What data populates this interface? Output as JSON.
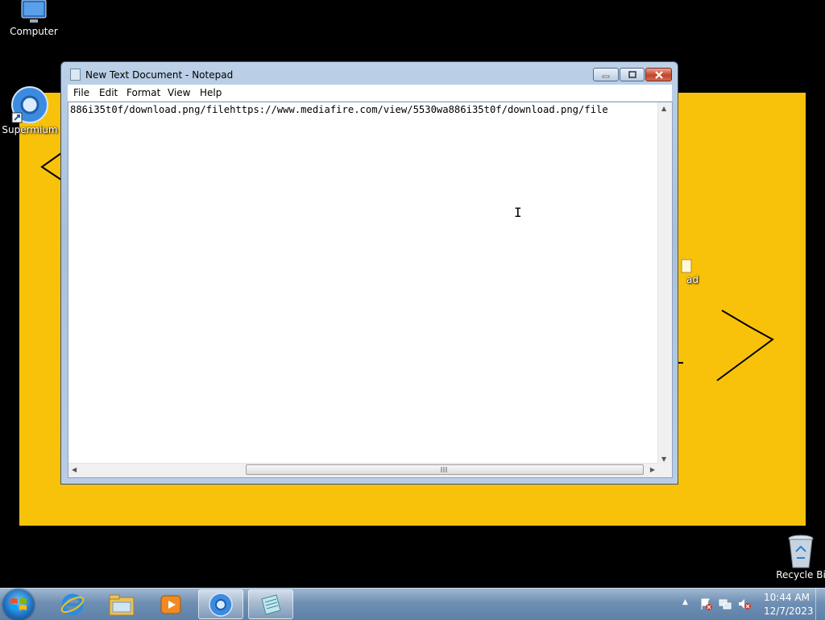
{
  "desktop": {
    "icons": [
      {
        "label": "Computer",
        "icon": "computer-icon"
      },
      {
        "label": "Supermium",
        "icon": "browser-icon"
      },
      {
        "label": "ad",
        "icon": "notepad-shortcut-icon"
      },
      {
        "label": "Recycle Bi",
        "icon": "recycle-bin-icon"
      }
    ],
    "wallpaper_color": "#f9c20a"
  },
  "notepad": {
    "title": "New Text Document - Notepad",
    "menu": [
      "File",
      "Edit",
      "Format",
      "View",
      "Help"
    ],
    "content": "886i35t0f/download.png/filehttps://www.mediafire.com/view/5530wa886i35t0f/download.png/file"
  },
  "taskbar": {
    "pinned": [
      "start-orb",
      "internet-explorer-icon",
      "file-explorer-icon",
      "media-player-icon",
      "supermium-icon",
      "notepad-icon"
    ],
    "clock": {
      "time": "10:44 AM",
      "date": "12/7/2023"
    }
  }
}
